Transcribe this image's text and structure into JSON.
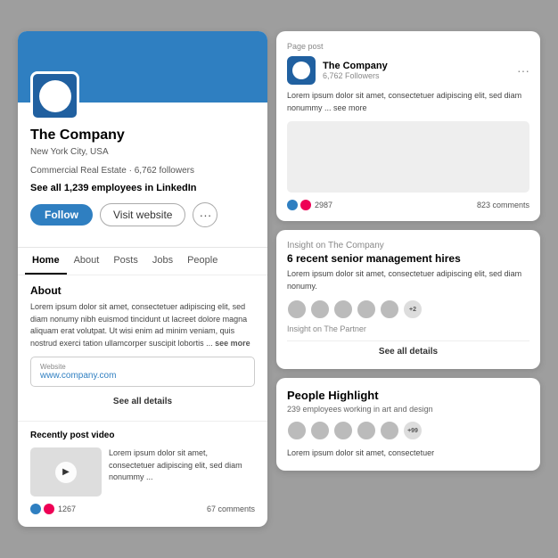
{
  "left": {
    "company_name": "The Company",
    "meta_line1": "New York City, USA",
    "meta_line2": "Commercial Real Estate · 6,762 followers",
    "employees_text": "See all 1,239 employees in LinkedIn",
    "btn_follow": "Follow",
    "btn_visit": "Visit website",
    "nav_tabs": [
      "Home",
      "About",
      "Posts",
      "Jobs",
      "People"
    ],
    "active_tab": "Home",
    "about_title": "About",
    "about_text": "Lorem ipsum dolor sit amet, consectetuer adipiscing elit, sed diam nonumy nibh euismod tincidunt ut lacreet dolore magna aliquam erat volutpat. Ut wisi enim ad minim veniam, quis nostrud exerci tation ullamcorper suscipit lobortis ...",
    "see_more": "see more",
    "website_label": "Website",
    "website_url": "www.company.com",
    "see_all_details": "See all details",
    "video_section_title": "Recently post video",
    "video_text": "Lorem ipsum dolor sit amet, consectetuer adipiscing elit, sed diam nonummy ...",
    "reaction_count": "1267",
    "comments_count": "67 comments"
  },
  "right": {
    "page_post_label": "Page post",
    "post_company": "The Company",
    "post_followers": "6,762 Followers",
    "post_text": "Lorem ipsum dolor sit amet, consectetuer adipiscing elit, sed diam nonummy ... see more",
    "post_reactions": "2987",
    "post_comments": "823 comments",
    "insight_label": "Insight on The Company",
    "insight_heading": "6 recent senior management hires",
    "insight_text": "Lorem ipsum dolor sit amet, consectetuer adipiscing elit, sed diam nonumy.",
    "avatar_plus": "+2",
    "partner_label": "Insight on The Partner",
    "see_all_details": "See all details",
    "people_title": "People Highlight",
    "people_sub": "239 employees working in art and design",
    "people_avatar_plus": "+99",
    "people_text": "Lorem ipsum dolor sit amet, consectetuer"
  }
}
